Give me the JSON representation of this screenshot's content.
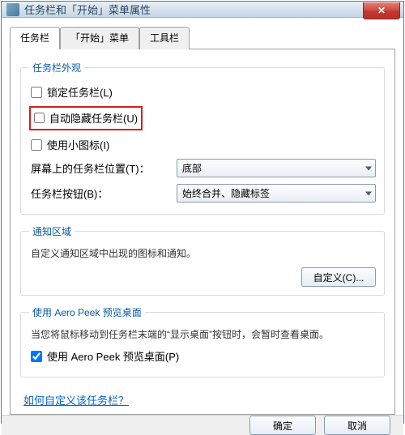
{
  "window": {
    "title": "任务栏和「开始」菜单属性"
  },
  "tabs": {
    "taskbar": "任务栏",
    "startmenu": "「开始」菜单",
    "toolbars": "工具栏"
  },
  "group_appearance": {
    "legend": "任务栏外观",
    "lock_label": "锁定任务栏(L)",
    "autohide_label": "自动隐藏任务栏(U)",
    "smallicons_label": "使用小图标(I)",
    "position_label": "屏幕上的任务栏位置(T)：",
    "position_value": "底部",
    "buttons_label": "任务栏按钮(B)：",
    "buttons_value": "始终合并、隐藏标签"
  },
  "group_notify": {
    "legend": "通知区域",
    "desc": "自定义通知区域中出现的图标和通知。",
    "customize_btn": "自定义(C)..."
  },
  "group_aero": {
    "legend": "使用 Aero Peek 预览桌面",
    "desc": "当您将鼠标移动到任务栏末端的“显示桌面”按钮时，会暂时查看桌面。",
    "enable_label": "使用 Aero Peek 预览桌面(P)"
  },
  "link": {
    "how_customize": "如何自定义该任务栏？"
  },
  "buttons": {
    "ok": "确定",
    "cancel": "取消"
  },
  "state": {
    "lock_checked": false,
    "autohide_checked": false,
    "smallicons_checked": false,
    "aero_checked": true
  }
}
